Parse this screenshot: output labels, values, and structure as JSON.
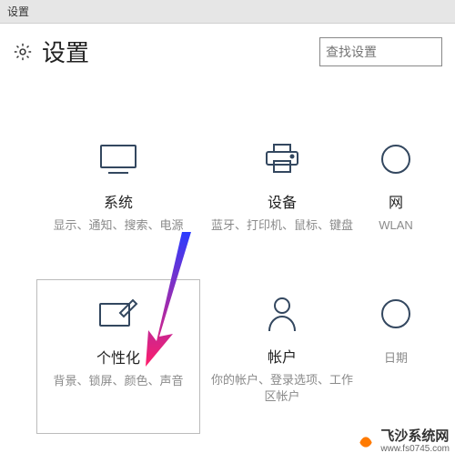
{
  "window_title": "设置",
  "page_title": "设置",
  "search_placeholder": "查找设置",
  "tiles": [
    {
      "title": "系统",
      "desc": "显示、通知、搜索、电源"
    },
    {
      "title": "设备",
      "desc": "蓝牙、打印机、鼠标、键盘"
    },
    {
      "title": "网",
      "desc": "WLAN"
    },
    {
      "title": "个性化",
      "desc": "背景、锁屏、颜色、声音"
    },
    {
      "title": "帐户",
      "desc": "你的帐户、登录选项、工作区帐户"
    },
    {
      "title": "",
      "desc": "日期"
    }
  ],
  "watermark": {
    "name": "飞沙系统网",
    "url": "www.fs0745.com"
  }
}
